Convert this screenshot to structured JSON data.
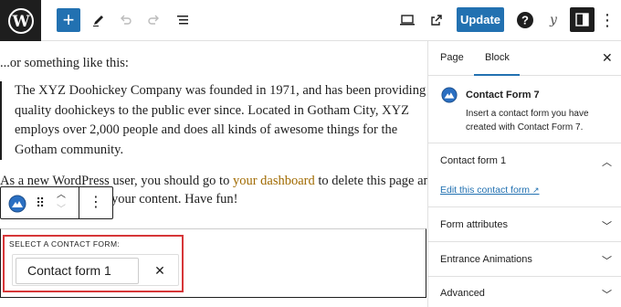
{
  "toolbar": {
    "add_label": "+",
    "update_label": "Update",
    "help_label": "?",
    "yoast_label": "y",
    "more_label": "⋮"
  },
  "editor": {
    "intro": "...or something like this:",
    "quote_lines": [
      "The XYZ Doohickey Company was founded in 1971, and has been providing",
      "quality doohickeys to the public ever since. Located in Gotham City, XYZ",
      "employs over 2,000 people and does all kinds of awesome things for the",
      "Gotham community."
    ],
    "para_before_link": "As a new WordPress user, you should go to ",
    "para_link": "your dashboard",
    "para_after_link": " to delete this page and",
    "para_line2": "your content. Have fun!"
  },
  "contact_form_block": {
    "label": "SELECT A CONTACT FORM:",
    "selected_value": "Contact form 1",
    "clear_label": "✕"
  },
  "sidebar": {
    "tabs": [
      "Page",
      "Block"
    ],
    "active_tab": "Block",
    "block_title": "Contact Form 7",
    "block_desc": "Insert a contact form you have created with Contact Form 7.",
    "panels": [
      {
        "title": "Contact form 1",
        "expanded": true,
        "link": "Edit this contact form"
      },
      {
        "title": "Form attributes",
        "expanded": false
      },
      {
        "title": "Entrance Animations",
        "expanded": false
      },
      {
        "title": "Advanced",
        "expanded": false
      }
    ]
  },
  "colors": {
    "accent": "#2271b1",
    "dark": "#1e1e1e",
    "highlight": "#d63638",
    "link": "#a06a00"
  }
}
